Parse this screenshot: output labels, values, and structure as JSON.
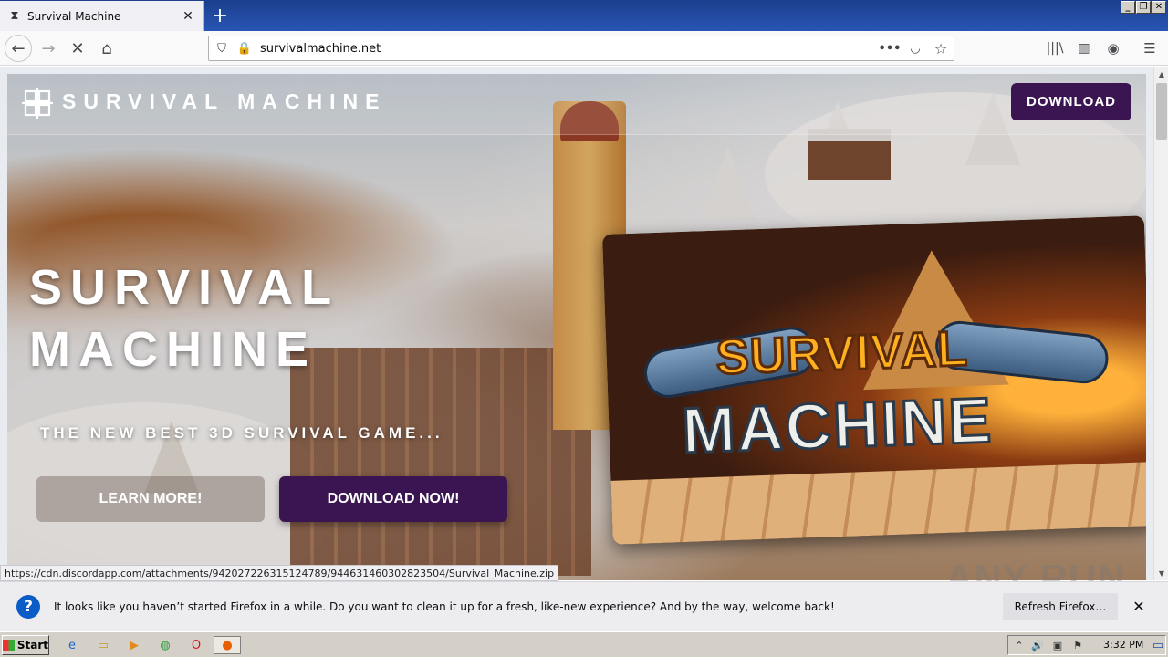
{
  "browser": {
    "tab_title": "Survival Machine",
    "url": "survivalmachine.net",
    "icons": [
      "back-icon",
      "forward-icon",
      "stop-icon",
      "home-icon",
      "shield-icon",
      "insecure-lock-icon",
      "more-icon",
      "pocket-icon",
      "bookmark-star-icon",
      "library-icon",
      "sidebar-icon",
      "account-icon",
      "menu-icon"
    ]
  },
  "site": {
    "logo_text": "SURVIVAL MACHINE",
    "nav_download": "DOWNLOAD",
    "headline_line1": "SURVIVAL",
    "headline_line2": "MACHINE",
    "subheadline": "THE NEW BEST 3D SURVIVAL GAME...",
    "learn_more": "LEARN MORE!",
    "download_now": "DOWNLOAD NOW!",
    "promo_logo_line1": "SURVIVAL",
    "promo_logo_line2": "MACHINE",
    "accent_color": "#3a1552"
  },
  "status_url": "https://cdn.discordapp.com/attachments/942027226315124789/944631460302823504/Survival_Machine.zip",
  "notification": {
    "message": "It looks like you haven’t started Firefox in a while. Do you want to clean it up for a fresh, like-new experience? And by the way, welcome back!",
    "refresh_button": "Refresh Firefox…"
  },
  "watermark": "ANY RUN",
  "taskbar": {
    "start_label": "Start",
    "clock": "3:32 PM"
  }
}
